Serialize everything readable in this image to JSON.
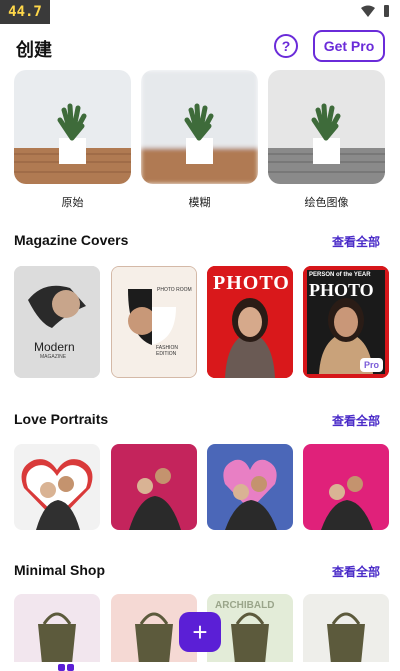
{
  "status": {
    "fps": "44.7",
    "wifi_icon": "wifi-icon",
    "battery_icon": "battery-icon"
  },
  "header": {
    "title": "创建",
    "help_label": "?",
    "get_pro_label": "Get Pro"
  },
  "filters": [
    {
      "label": "原始",
      "style": "color"
    },
    {
      "label": "模糊",
      "style": "blur"
    },
    {
      "label": "绘色图像",
      "style": "gray"
    }
  ],
  "sections": {
    "magazine": {
      "title": "Magazine Covers",
      "see_all": "查看全部",
      "cards": [
        {
          "title": "Modern",
          "subtitle": "MAGAZINE"
        },
        {
          "title": "PHOTO ROOM",
          "subtitle": "FASHION EDITION"
        },
        {
          "title": "PHOTO",
          "subtitle": ""
        },
        {
          "title": "PHOTO",
          "subtitle": "PERSON of the YEAR",
          "pro": "Pro"
        }
      ]
    },
    "love": {
      "title": "Love Portraits",
      "see_all": "查看全部"
    },
    "minimal": {
      "title": "Minimal Shop",
      "see_all": "查看全部",
      "cards": [
        {
          "label": ""
        },
        {
          "label": ""
        },
        {
          "label": "ARCHIBALD"
        },
        {
          "label": ""
        }
      ]
    }
  },
  "fab": {
    "label": "+"
  },
  "colors": {
    "accent": "#6a2bd9",
    "see_all": "#4a2bc8",
    "fab": "#5b1fd6"
  }
}
